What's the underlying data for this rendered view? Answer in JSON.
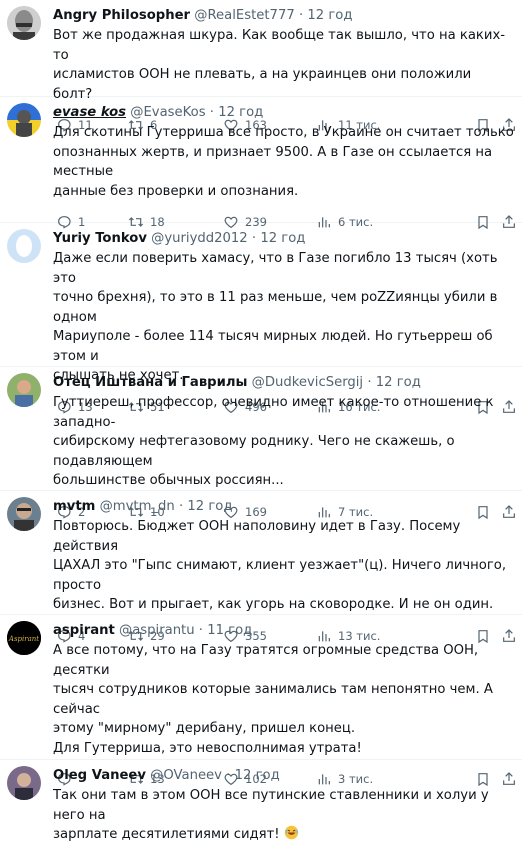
{
  "tweets": [
    {
      "name": "Angry Philosopher",
      "handle": "@RealEstet777",
      "time": "12 год",
      "text": "Вот же продажная шкура. Как вообще так вышло, что на каких-то\nисламистов ООН не плевать, а на украинцев они положили болт?",
      "replies": "11",
      "retweets": "6",
      "likes": "163",
      "views": "11 тис."
    },
    {
      "name": "evase kos",
      "handle": "@EvaseKos",
      "time": "12 год",
      "text": "Для скотины Гутерриша все просто, в Украине он считает только\nопознанных жертв, и признает 9500. А в Газе он ссылается на местные\nданные без проверки и опознания.",
      "replies": "1",
      "retweets": "18",
      "likes": "239",
      "views": "6 тис."
    },
    {
      "name": "Yuriy Tonkov",
      "handle": "@yuriydd2012",
      "time": "12 год",
      "text": "Даже если поверить хамасу, что в Газе погибло 13 тысяч (хоть это\nточно брехня), то это в 11 раз меньше, чем роZZиянцы убили в одном\nМариуполе - более 114 тысяч мирных людей. Но гутьеррeш об этом и\nслышать не хочет.",
      "replies": "13",
      "retweets": "51",
      "likes": "496",
      "views": "16 тис."
    },
    {
      "name": "Отец Иштвана и Гаврилы",
      "handle": "@DudkevicSergij",
      "time": "12 год",
      "text": "Гуттиереш, профессор, очевидно имеет какое-то отношение к западно-\nсибирскому нефтегазовому роднику. Чего не скажешь, о подавляющем\nбольшинстве обычных россиян...",
      "replies": "2",
      "retweets": "10",
      "likes": "169",
      "views": "7 тис."
    },
    {
      "name": "mvtm",
      "handle": "@mvtm_dn",
      "time": "12 год",
      "text": "Повторюсь. Бюджет ООН наполовину идет в Газу. Посему действия\nЦАХАЛ это \"Гыпс снимают, клиент уезжает\"(ц). Ничего личного, просто\nбизнес. Вот и прыгает, как угорь на сковородке. И не он один.",
      "replies": "4",
      "retweets": "29",
      "likes": "355",
      "views": "13 тис."
    },
    {
      "name": "aspirant",
      "handle": "@aspirantu",
      "time": "11 год",
      "text": "А все потому, что на Газу тратятся огромные средства ООН, десятки\nтысяч сотрудников которые занимались там непонятно чем. А сейчас\nэтому \"мирному\" дерибану, пришел конец.\nДля Гутерриша, это невосполнимая утрата!",
      "replies": "",
      "retweets": "13",
      "likes": "102",
      "views": "3 тис."
    },
    {
      "name": "Oleg Vaneev",
      "handle": "@OVaneev",
      "time": "12 год",
      "text": "Так они там в этом ООН все путинские ставленники и холуи у него на\nзарплате десятилетиями сидят!",
      "replies": "",
      "retweets": "",
      "likes": "",
      "views": ""
    }
  ],
  "aspirant_logo_text": "Aspirant",
  "colors": {
    "text": "#0f1419",
    "muted": "#536471",
    "divider": "#eff3f4"
  },
  "icons": [
    "reply-icon",
    "retweet-icon",
    "like-icon",
    "views-icon",
    "bookmark-icon",
    "share-icon",
    "laughing-emoji-icon"
  ]
}
